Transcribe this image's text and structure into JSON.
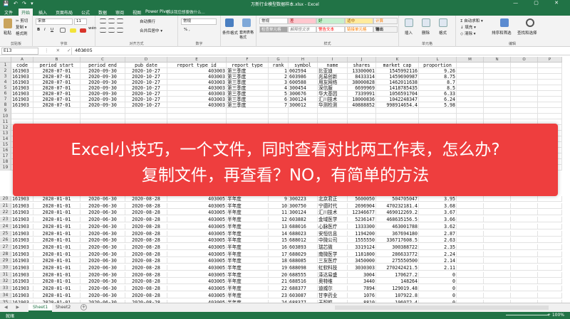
{
  "window": {
    "title": "万新行业模型数据样本.xlsx - Excel",
    "quick_access": "💾 ↶ ↷ ▾",
    "controls": "—  ▢  ✕"
  },
  "tabs": [
    "文件",
    "开始",
    "插入",
    "页面布局",
    "公式",
    "数据",
    "审阅",
    "视图",
    "Power Pivot"
  ],
  "tell_me": "告诉我您想要做什么...",
  "ribbon": {
    "clipboard": {
      "label": "剪贴板",
      "paste": "粘贴",
      "cut": "✂ 剪切",
      "copy": "复制 ▾",
      "format_painter": "格式刷"
    },
    "font": {
      "label": "字体",
      "name": "宋体",
      "size": "11",
      "bold": "B",
      "italic": "I",
      "underline": "U",
      "wen": "wén"
    },
    "alignment": {
      "label": "对齐方式",
      "wrap": "自动换行",
      "merge": "合并后居中 ▾"
    },
    "number": {
      "label": "数字",
      "format": "常规",
      "pct": "% ,"
    },
    "cond": {
      "cond_format": "条件格式",
      "as_table": "套用表格格式",
      "label": "样式"
    },
    "styles": {
      "normal": "常规",
      "bad": "差",
      "good": "好",
      "neutral": "适中",
      "calc": "计算",
      "check": "检查单元格",
      "explain": "解释性文本",
      "warn": "警告文本",
      "linked": "链接单元格",
      "output": "输出"
    },
    "cells": {
      "label": "单元格",
      "insert": "插入",
      "delete": "删除",
      "format": "格式"
    },
    "editing": {
      "label": "编辑",
      "autosum": "Σ 自动求和 ▾",
      "fill": "↓ 填充 ▾",
      "clear": "◇ 清除 ▾",
      "sort": "排序和筛选",
      "find": "查找和选择"
    }
  },
  "formula_bar": {
    "name_box": "E13",
    "icons": "⋮ ✕ ✓ fx",
    "value": "403005"
  },
  "columns": [
    "A",
    "B",
    "C",
    "D",
    "E",
    "F",
    "G",
    "H",
    "I",
    "J",
    "K",
    "L",
    "M",
    "N",
    "O",
    "P"
  ],
  "headers": [
    "code",
    "period_start",
    "period_end",
    "pub_date",
    "report_type_id",
    "report_type",
    "rank",
    "symbol",
    "name",
    "shares",
    "market_cap",
    "proportion"
  ],
  "rows_top": [
    {
      "n": "2",
      "v": [
        "161903",
        "2020-07-01",
        "2020-09-30",
        "2020-10-27",
        "403003",
        "第三季度",
        "1",
        "002594",
        "比亚迪",
        "13300001",
        "1545992116",
        "9.26"
      ]
    },
    {
      "n": "3",
      "v": [
        "161903",
        "2020-07-01",
        "2020-09-30",
        "2020-10-27",
        "403003",
        "第三季度",
        "2",
        "603986",
        "兆易创新",
        "8433314",
        "1459690987",
        "8.75"
      ]
    },
    {
      "n": "4",
      "v": [
        "161903",
        "2020-07-01",
        "2020-09-30",
        "2020-10-27",
        "403003",
        "第三季度",
        "3",
        "600588",
        "用友网络",
        "38000828",
        "1462011638",
        "8.7"
      ]
    },
    {
      "n": "5",
      "v": [
        "161903",
        "2020-07-01",
        "2020-09-30",
        "2020-10-27",
        "403003",
        "第三季度",
        "4",
        "300454",
        "深信服",
        "6699969",
        "1418785435",
        "8.5"
      ]
    },
    {
      "n": "6",
      "v": [
        "161903",
        "2020-07-01",
        "2020-09-30",
        "2020-10-27",
        "403003",
        "第三季度",
        "5",
        "300676",
        "华大基因",
        "7339991",
        "1056591704",
        "6.33"
      ]
    },
    {
      "n": "7",
      "v": [
        "161903",
        "2020-07-01",
        "2020-09-30",
        "2020-10-27",
        "403003",
        "第三季度",
        "6",
        "300124",
        "汇川技术",
        "18000836",
        "1042248347",
        "6.24"
      ]
    },
    {
      "n": "8",
      "v": [
        "161903",
        "2020-07-01",
        "2020-09-30",
        "2020-10-27",
        "403003",
        "第三季度",
        "7",
        "300012",
        "华测检测",
        "40888852",
        "998914654.4",
        "5.98"
      ]
    }
  ],
  "rows_bottom": [
    {
      "n": "20",
      "v": [
        "161903",
        "2020-01-01",
        "2020-06-30",
        "2020-08-28",
        "403005",
        "半年度",
        "9",
        "300223",
        "北京君正",
        "5600050",
        "504705047",
        "3.95"
      ]
    },
    {
      "n": "21",
      "v": [
        "161903",
        "2020-01-01",
        "2020-06-30",
        "2020-08-28",
        "403005",
        "半年度",
        "10",
        "300750",
        "宁德时代",
        "2696904",
        "470232181.4",
        "3.68"
      ]
    },
    {
      "n": "22",
      "v": [
        "161903",
        "2020-01-01",
        "2020-06-30",
        "2020-08-28",
        "403005",
        "半年度",
        "11",
        "300124",
        "汇川技术",
        "12346677",
        "469012269.2",
        "3.67"
      ]
    },
    {
      "n": "23",
      "v": [
        "161903",
        "2020-01-01",
        "2020-06-30",
        "2020-08-28",
        "403005",
        "半年度",
        "12",
        "603882",
        "金域医学",
        "5236147",
        "468635156.5",
        "3.66"
      ]
    },
    {
      "n": "24",
      "v": [
        "161903",
        "2020-01-01",
        "2020-06-30",
        "2020-08-28",
        "403005",
        "半年度",
        "13",
        "688016",
        "心脉医疗",
        "1333300",
        "463001788",
        "3.62"
      ]
    },
    {
      "n": "25",
      "v": [
        "161903",
        "2020-01-01",
        "2020-06-30",
        "2020-08-28",
        "403005",
        "半年度",
        "14",
        "688023",
        "安恒信息",
        "1194200",
        "367694180",
        "2.87"
      ]
    },
    {
      "n": "26",
      "v": [
        "161903",
        "2020-01-01",
        "2020-06-30",
        "2020-08-28",
        "403005",
        "半年度",
        "15",
        "688012",
        "中微公司",
        "1555550",
        "336717608.5",
        "2.63"
      ]
    },
    {
      "n": "27",
      "v": [
        "161903",
        "2020-01-01",
        "2020-06-30",
        "2020-08-28",
        "403005",
        "半年度",
        "16",
        "603893",
        "瑞芯微",
        "3319124",
        "300388722",
        "2.35"
      ]
    },
    {
      "n": "28",
      "v": [
        "161903",
        "2020-01-01",
        "2020-06-30",
        "2020-08-28",
        "403005",
        "半年度",
        "17",
        "688029",
        "南微医学",
        "1181800",
        "286633772",
        "2.24"
      ]
    },
    {
      "n": "29",
      "v": [
        "161903",
        "2020-01-01",
        "2020-06-30",
        "2020-08-28",
        "403005",
        "半年度",
        "18",
        "688085",
        "三友医疗",
        "3450000",
        "275550500",
        "2.14"
      ]
    },
    {
      "n": "30",
      "v": [
        "161903",
        "2020-01-01",
        "2020-06-30",
        "2020-08-28",
        "403005",
        "半年度",
        "19",
        "688098",
        "虹软科技",
        "3030303",
        "270242421.5",
        "2.11"
      ]
    },
    {
      "n": "31",
      "v": [
        "161903",
        "2020-01-01",
        "2020-06-30",
        "2020-08-28",
        "403005",
        "半年度",
        "20",
        "688555",
        "泽达易盛",
        "3004",
        "170627.2",
        "0"
      ]
    },
    {
      "n": "32",
      "v": [
        "161903",
        "2020-01-01",
        "2020-06-30",
        "2020-08-28",
        "403005",
        "半年度",
        "21",
        "688516",
        "奥特维",
        "3440",
        "148264",
        "0"
      ]
    },
    {
      "n": "33",
      "v": [
        "161903",
        "2020-01-01",
        "2020-06-30",
        "2020-08-28",
        "403005",
        "半年度",
        "22",
        "688377",
        "迪威尔",
        "7894",
        "129019.48",
        "0"
      ]
    },
    {
      "n": "34",
      "v": [
        "161903",
        "2020-01-01",
        "2020-06-30",
        "2020-08-28",
        "403005",
        "半年度",
        "23",
        "603087",
        "甘李药业",
        "1076",
        "107922.8",
        "0"
      ]
    },
    {
      "n": "35",
      "v": [
        "161903",
        "2020-01-01",
        "2020-06-30",
        "2020-08-28",
        "403005",
        "半年度",
        "24",
        "688377",
        "天智航",
        "8810",
        "106072.4",
        "0"
      ]
    }
  ],
  "banner": {
    "line1": "Excel小技巧，一个文件，同时查看对比两工作表，怎么办?",
    "line2": "复制文件，再查看？NO，有简单的方法"
  },
  "sheets": [
    "Sheet1",
    "Sheet2"
  ],
  "sheet_nav": "◀ ▶",
  "add_sheet": "+",
  "status": {
    "ready": "就绪",
    "zoom": "+ 100%"
  }
}
